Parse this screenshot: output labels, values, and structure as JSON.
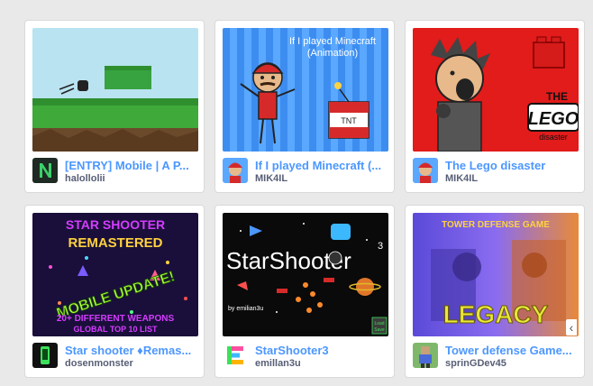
{
  "projects": [
    {
      "title": "[ENTRY] Mobile | A P...",
      "author": "halollolii",
      "thumb_icon": "platformer-thumbnail",
      "avatar_icon": "green-n-logo-avatar"
    },
    {
      "title": "If I played Minecraft (...",
      "author": "MIK4IL",
      "thumb_icon": "minecraft-animation-thumbnail",
      "avatar_icon": "mario-avatar",
      "thumb_text": {
        "line1": "If I played Minecraft",
        "line2": "(Animation)",
        "tnt": "TNT"
      }
    },
    {
      "title": "The Lego disaster",
      "author": "MIK4IL",
      "thumb_icon": "lego-disaster-thumbnail",
      "avatar_icon": "mario-avatar",
      "thumb_text": {
        "the": "THE",
        "lego": "LEGO",
        "disaster": "disaster"
      }
    },
    {
      "title": "Star shooter ♦Remas...",
      "author": "dosenmonster",
      "thumb_icon": "star-shooter-remastered-thumbnail",
      "avatar_icon": "green-phone-avatar",
      "thumb_text": {
        "line1": "STAR SHOOTER",
        "line2": "REMASTERED",
        "banner": "MOBILE UPDATE!",
        "line3": "20+ DIFFERENT WEAPONS",
        "line4": "GLOBAL TOP 10 LIST"
      }
    },
    {
      "title": "StarShooter3",
      "author": "emillan3u",
      "thumb_icon": "starshooter3-thumbnail",
      "avatar_icon": "e-logo-avatar",
      "thumb_text": {
        "logo": "StarShooter",
        "num": "3",
        "credit": "by emilian3u",
        "badge1": "Load",
        "badge2": "Save"
      }
    },
    {
      "title": "Tower defense Game...",
      "author": "sprinGDev45",
      "thumb_icon": "tower-defense-thumbnail",
      "avatar_icon": "pixel-character-avatar",
      "thumb_text": {
        "top": "TOWER DEFENSE GAME",
        "legacy": "LEGACY"
      }
    }
  ],
  "carousel": {
    "next_glyph": "‹",
    "next_icon": "chevron-left-icon"
  },
  "colors": {
    "title": "#4c97ff",
    "author": "#575e75",
    "background": "#e9e9e9"
  }
}
